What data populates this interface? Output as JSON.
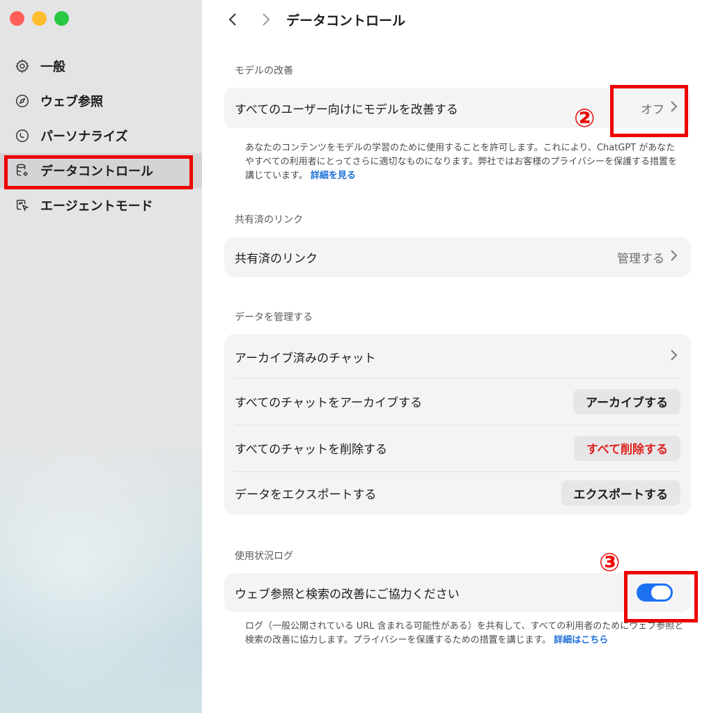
{
  "sidebar": {
    "items": [
      {
        "label": "一般",
        "icon": "gear-icon"
      },
      {
        "label": "ウェブ参照",
        "icon": "compass-icon"
      },
      {
        "label": "パーソナライズ",
        "icon": "personalize-icon"
      },
      {
        "label": "データコントロール",
        "icon": "database-gear-icon",
        "active": true
      },
      {
        "label": "エージェントモード",
        "icon": "agent-cursor-icon"
      }
    ]
  },
  "header": {
    "title": "データコントロール"
  },
  "sections": {
    "model": {
      "label": "モデルの改善",
      "row_label": "すべてのユーザー向けにモデルを改善する",
      "row_value": "オフ",
      "desc": "あなたのコンテンツをモデルの学習のために使用することを許可します。これにより、ChatGPT があなたやすべての利用者にとってさらに適切なものになります。弊社ではお客様のプライバシーを保護する措置を講じています。",
      "desc_link": "詳細を見る"
    },
    "shared": {
      "label": "共有済のリンク",
      "row_label": "共有済のリンク",
      "row_value": "管理する"
    },
    "data": {
      "label": "データを管理する",
      "archived_label": "アーカイブ済みのチャット",
      "archive_all_label": "すべてのチャットをアーカイブする",
      "archive_all_button": "アーカイブする",
      "delete_all_label": "すべてのチャットを削除する",
      "delete_all_button": "すべて削除する",
      "export_label": "データをエクスポートする",
      "export_button": "エクスポートする"
    },
    "usage": {
      "label": "使用状況ログ",
      "row_label": "ウェブ参照と検索の改善にご協力ください",
      "toggle_on": true,
      "desc": "ログ（一般公開されている URL 含まれる可能性がある）を共有して、すべての利用者のためにウェブ参照と検索の改善に協力します。プライバシーを保護するための措置を講じます。",
      "desc_link": "詳細はこちら"
    }
  },
  "annotations": {
    "marker_2": "②",
    "marker_3": "③"
  },
  "colors": {
    "annotation_red": "#ee0000",
    "link_blue": "#1d6fd8",
    "toggle_blue": "#1d72f2",
    "danger_red": "#e0201c"
  }
}
